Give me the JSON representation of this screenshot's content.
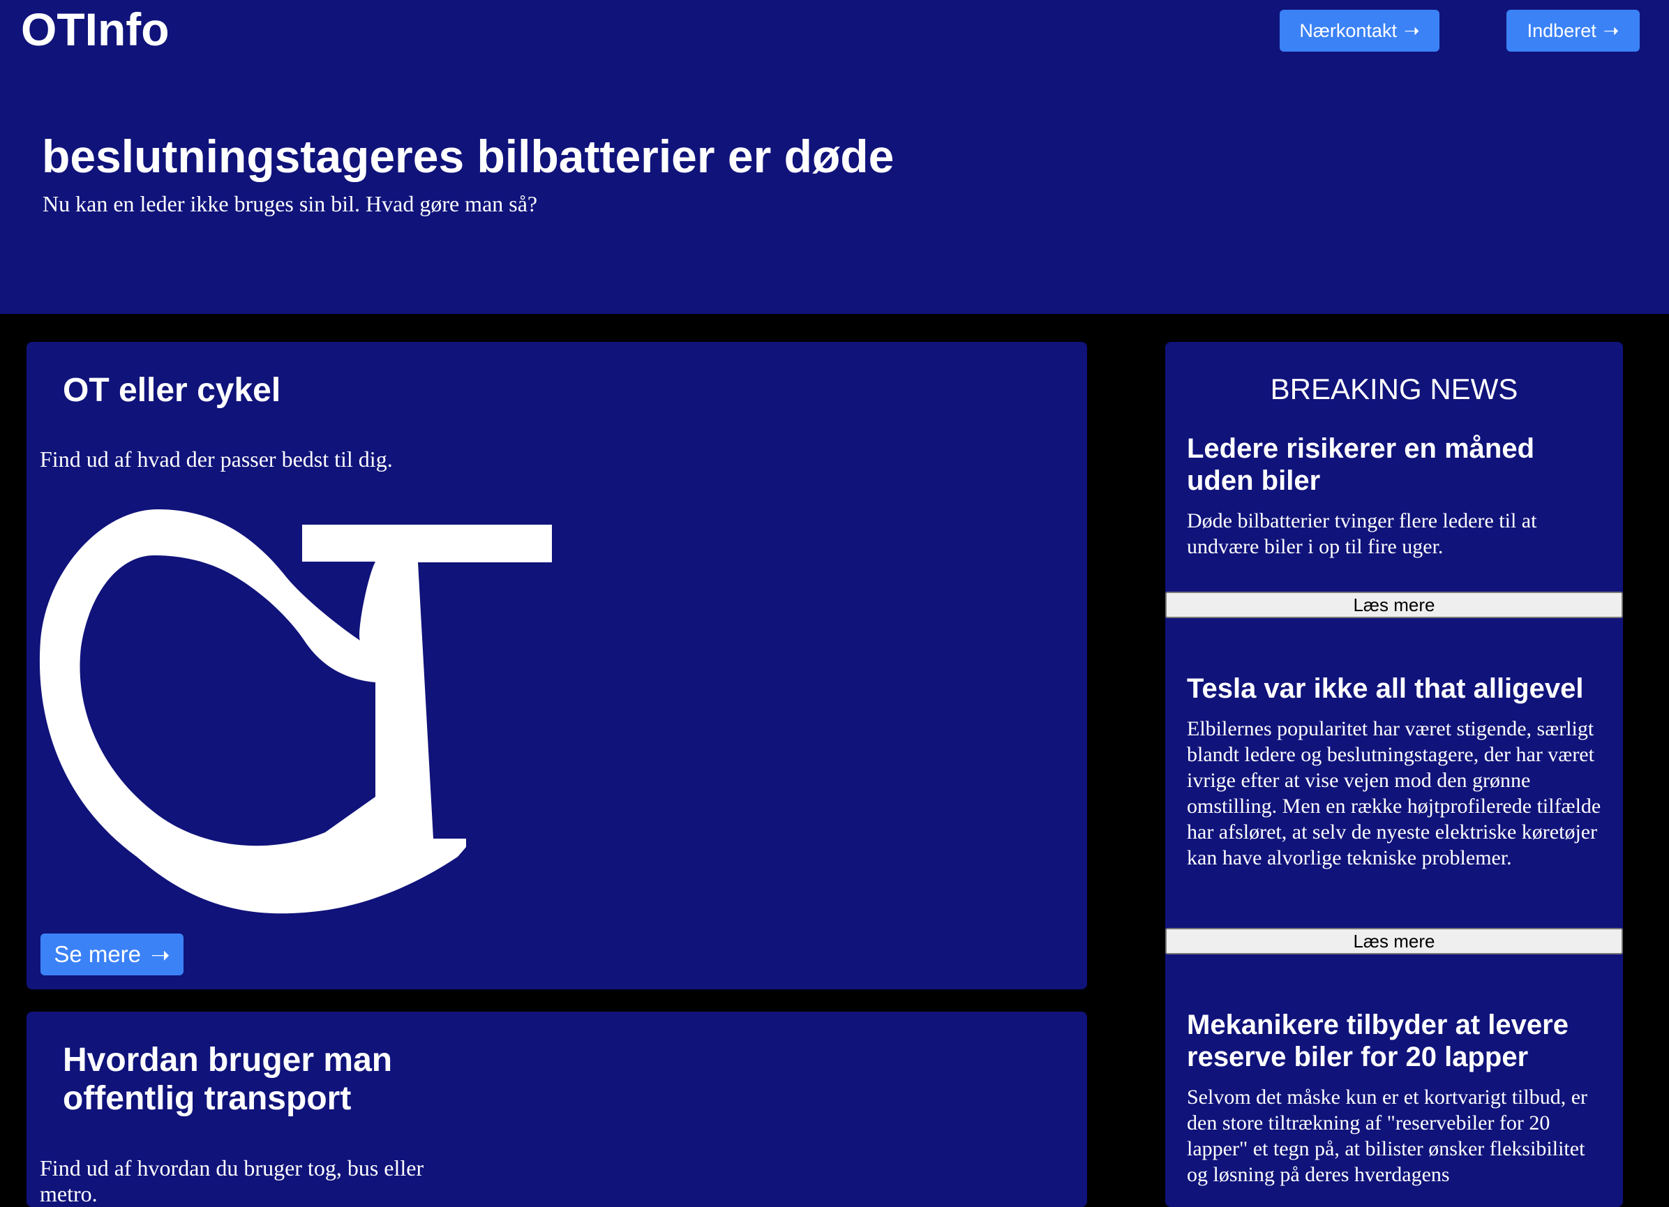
{
  "header": {
    "logo": "OTInfo",
    "nav": {
      "contact_label": "Nærkontakt",
      "report_label": "Indberet",
      "arrow": "➝"
    }
  },
  "hero": {
    "title": "beslutningstageres bilbatterier er døde",
    "subtitle": "Nu kan en leder ikke bruges sin bil. Hvad gøre man så?"
  },
  "cards": [
    {
      "title": "OT eller cykel",
      "text": "Find ud af hvad der passer bedst til dig.",
      "image_icon": "ot-logo-icon",
      "button_label": "Se mere",
      "button_arrow": "➝"
    },
    {
      "title": "Hvordan bruger man offentlig transport",
      "text": "Find ud af hvordan du bruger tog, bus eller metro."
    }
  ],
  "sidebar": {
    "heading": "BREAKING NEWS",
    "items": [
      {
        "title": "Ledere risikerer en måned uden biler",
        "text": "Døde bilbatterier tvinger flere ledere til at undvære biler i op til fire uger.",
        "button_label": "Læs mere"
      },
      {
        "title": "Tesla var ikke all that alligevel",
        "text": "Elbilernes popularitet har været stigende, særligt blandt ledere og beslutningstagere, der har været ivrige efter at vise vejen mod den grønne omstilling. Men en række højtprofilerede tilfælde har afsløret, at selv de nyeste elektriske køretøjer kan have alvorlige tekniske problemer.",
        "button_label": "Læs mere"
      },
      {
        "title": "Mekanikere tilbyder at levere reserve biler for 20 lapper",
        "text": "Selvom det måske kun er et kortvarigt tilbud, er den store tiltrækning af \"reservebiler for 20 lapper\" et tegn på, at bilister ønsker fleksibilitet og løsning på deres hverdagens"
      }
    ]
  },
  "colors": {
    "background": "#000000",
    "panel": "#10137a",
    "accent": "#3b82f6",
    "text": "#ffffff"
  }
}
